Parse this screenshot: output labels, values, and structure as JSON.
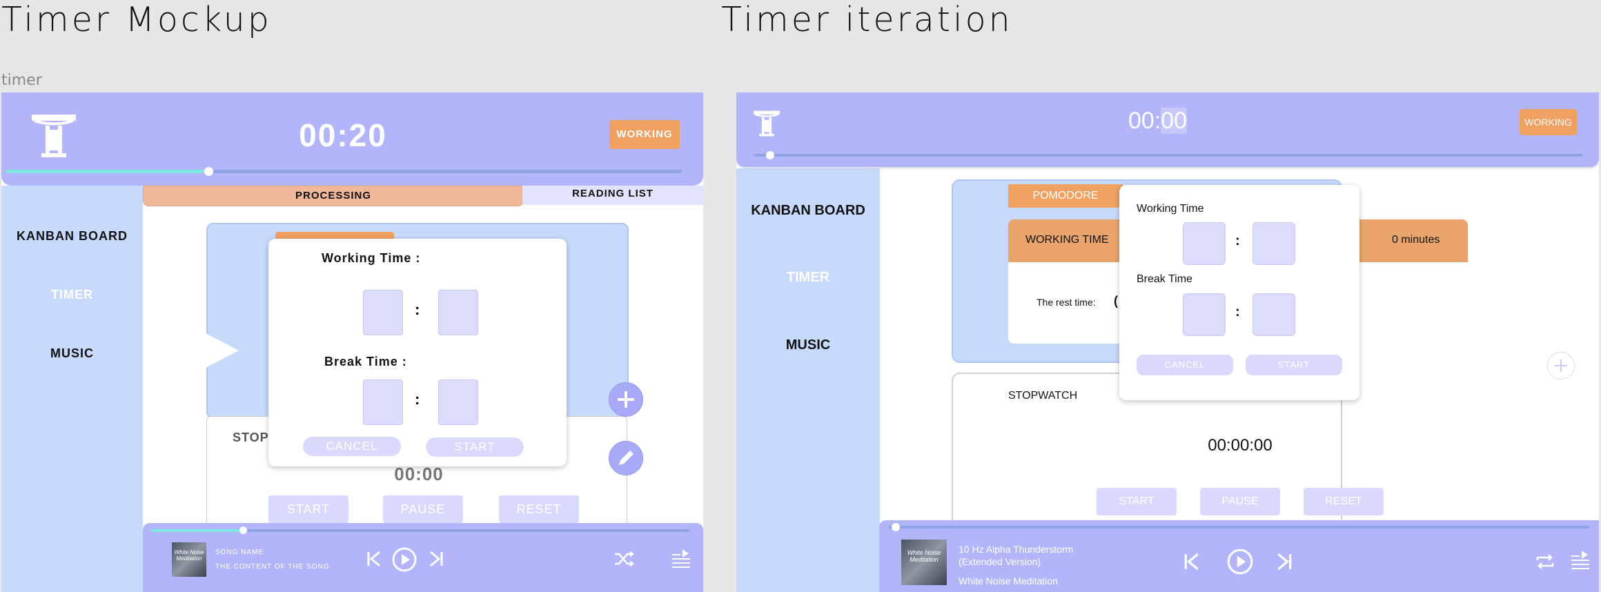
{
  "page": {
    "left_title": "Timer Mockup",
    "right_title": "Timer iteration",
    "frame_label": "timer"
  },
  "mockup": {
    "timer_display": "00:20",
    "status_button": "WORKING",
    "progress_fraction": 0.3,
    "tabs": [
      "PROCESSING",
      "READING LIST"
    ],
    "nav": [
      "KANBAN BOARD",
      "TIMER",
      "MUSIC"
    ],
    "modal": {
      "working_label": "Working Time :",
      "break_label": "Break Time :",
      "colon": ":",
      "cancel": "CANCEL",
      "start": "START"
    },
    "stopwatch_label": "STOP",
    "stopwatch_time": "00:00",
    "stopwatch_buttons": [
      "START",
      "PAUSE",
      "RESET"
    ],
    "player": {
      "song_name": "SONG NAME",
      "song_content": "THE CONTENT OF THE SONG",
      "album_text": "White Noise Meditation",
      "progress_fraction": 0.17
    }
  },
  "iteration": {
    "timer_hh": "00:",
    "timer_mm": "00",
    "status_button": "WORKING",
    "progress_fraction": 0.02,
    "nav": [
      "KANBAN BOARD",
      "TIMER",
      "MUSIC"
    ],
    "pomodore_tab": "POMODORE",
    "working_time_label": "WORKING TIME",
    "minutes_value": "0 minutes",
    "rest_time_label": "The rest time:",
    "rest_time_partial": "(",
    "modal": {
      "working_label": "Working Time",
      "break_label": "Break Time",
      "colon": ":",
      "cancel": "CANCEL",
      "start": "START"
    },
    "stopwatch_label": "STOPWATCH",
    "stopwatch_time": "00:00:00",
    "stopwatch_buttons": [
      "START",
      "PAUSE",
      "RESET"
    ],
    "player": {
      "song_title_1": "10 Hz Alpha Thunderstorm",
      "song_title_2": "(Extended Version)",
      "artist": "White Noise Meditation",
      "album_text": "White Noise Meditation",
      "progress_fraction": 0.01
    }
  },
  "colors": {
    "header": "#b3b5fb",
    "sidebar": "#c7d9fc",
    "accent_orange": "#f0a061",
    "progress_teal": "#7de8e0",
    "timer_nav_active": "#ffffff"
  },
  "icons": [
    "logo-t-icon",
    "play-triangle-icon",
    "plus-icon",
    "pencil-icon",
    "skip-back-icon",
    "play-circle-icon",
    "skip-forward-icon",
    "shuffle-icon",
    "repeat-icon",
    "playlist-icon"
  ]
}
